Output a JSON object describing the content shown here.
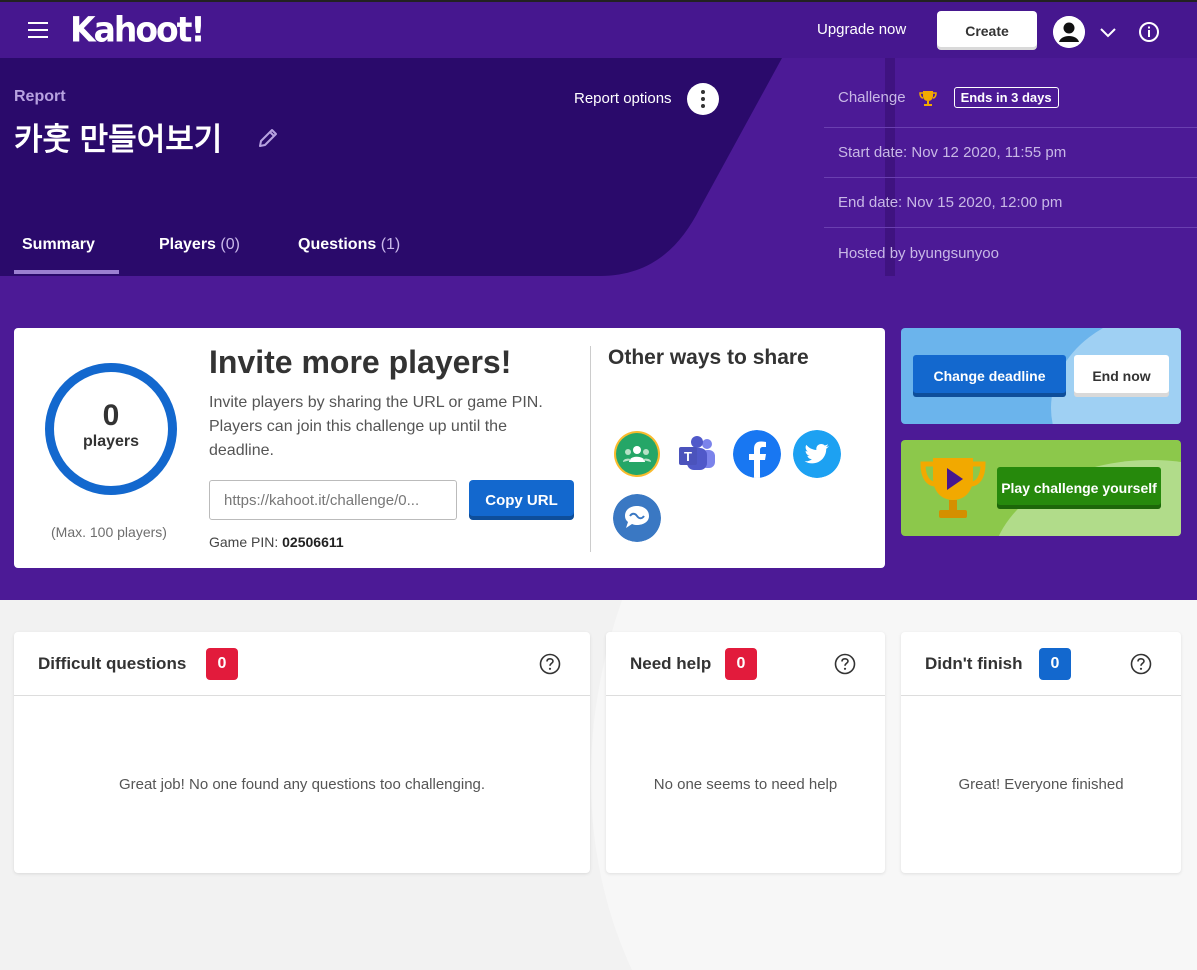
{
  "topbar": {
    "logo": "Kahoot!",
    "upgrade": "Upgrade now",
    "create": "Create"
  },
  "header": {
    "label": "Report",
    "title": "카훗 만들어보기",
    "options": "Report options",
    "tabs": [
      {
        "label": "Summary",
        "count": ""
      },
      {
        "label": "Players",
        "count": "(0)"
      },
      {
        "label": "Questions",
        "count": "(1)"
      }
    ],
    "info": {
      "challenge": "Challenge",
      "ends": "Ends in 3 days",
      "start": "Start date:  Nov 12 2020, 11:55 pm",
      "end": "End date:  Nov 15 2020, 12:00 pm",
      "hosted": "Hosted by byungsunyoo"
    }
  },
  "invite": {
    "players_count": "0",
    "players_label": "players",
    "max": "(Max. 100 players)",
    "title": "Invite more players!",
    "text": "Invite players by sharing the URL or game PIN. Players can join this challenge up until the deadline.",
    "url": "https://kahoot.it/challenge/0...",
    "copy": "Copy URL",
    "pin_label": "Game PIN:",
    "pin": "02506611",
    "other_title": "Other ways to share"
  },
  "actions": {
    "change": "Change deadline",
    "end": "End now",
    "play": "Play challenge yourself"
  },
  "stats": [
    {
      "title": "Difficult questions",
      "count": "0",
      "color": "#e21b3c",
      "message": "Great job! No one found any questions too challenging."
    },
    {
      "title": "Need help",
      "count": "0",
      "color": "#e21b3c",
      "message": "No one seems to need help"
    },
    {
      "title": "Didn't finish",
      "count": "0",
      "color": "#1368ce",
      "message": "Great! Everyone finished"
    }
  ]
}
